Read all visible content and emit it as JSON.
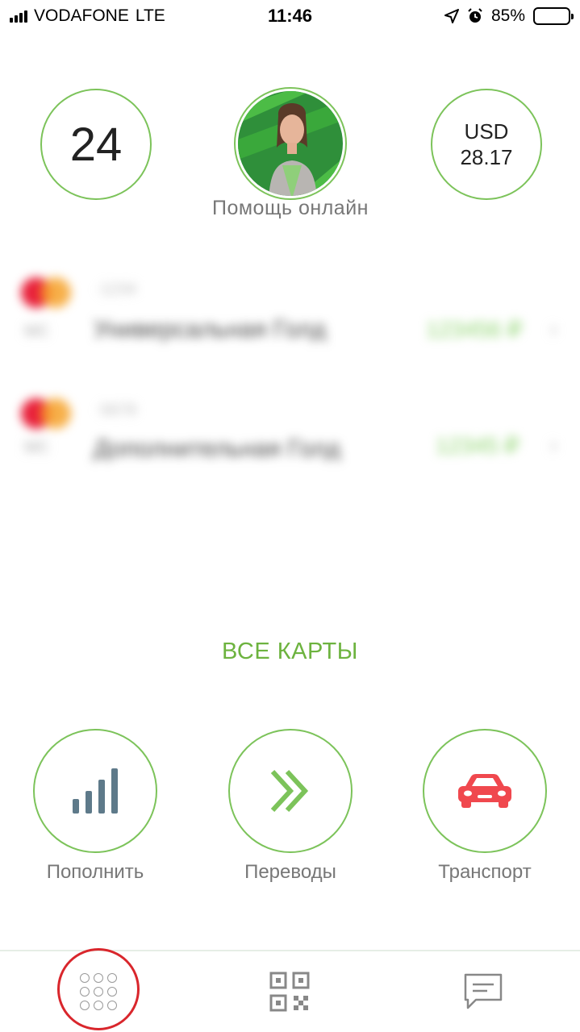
{
  "status_bar": {
    "carrier": "VODAFONE",
    "network": "LTE",
    "time": "11:46",
    "battery": "85%",
    "battery_level": 0.85
  },
  "header": {
    "count": "24",
    "help_label": "Помощь онлайн",
    "currency": "USD",
    "rate": "28.17"
  },
  "cards": [
    {
      "mask": "·1234",
      "system": "MC",
      "name": "Универсальная Голд",
      "amount": "123456 ₽"
    },
    {
      "mask": "·5678",
      "system": "MC",
      "name": "Дополнительная Голд",
      "amount": "12345 ₽"
    }
  ],
  "all_cards_label": "ВСЕ КАРТЫ",
  "actions": [
    {
      "label": "Пополнить",
      "icon": "signal-bars-icon"
    },
    {
      "label": "Переводы",
      "icon": "double-chevron-right-icon"
    },
    {
      "label": "Транспорт",
      "icon": "car-icon"
    }
  ],
  "tab_bar": {
    "items": [
      {
        "icon": "menu-grid-icon",
        "active": true
      },
      {
        "icon": "qr-code-icon",
        "active": false
      },
      {
        "icon": "chat-icon",
        "active": false
      }
    ]
  },
  "colors": {
    "accent_green": "#6db33f",
    "ring_green": "#7cc35a",
    "highlight_red": "#d9262c",
    "car_red": "#f0484e",
    "bars_gray": "#5e7a8a"
  }
}
